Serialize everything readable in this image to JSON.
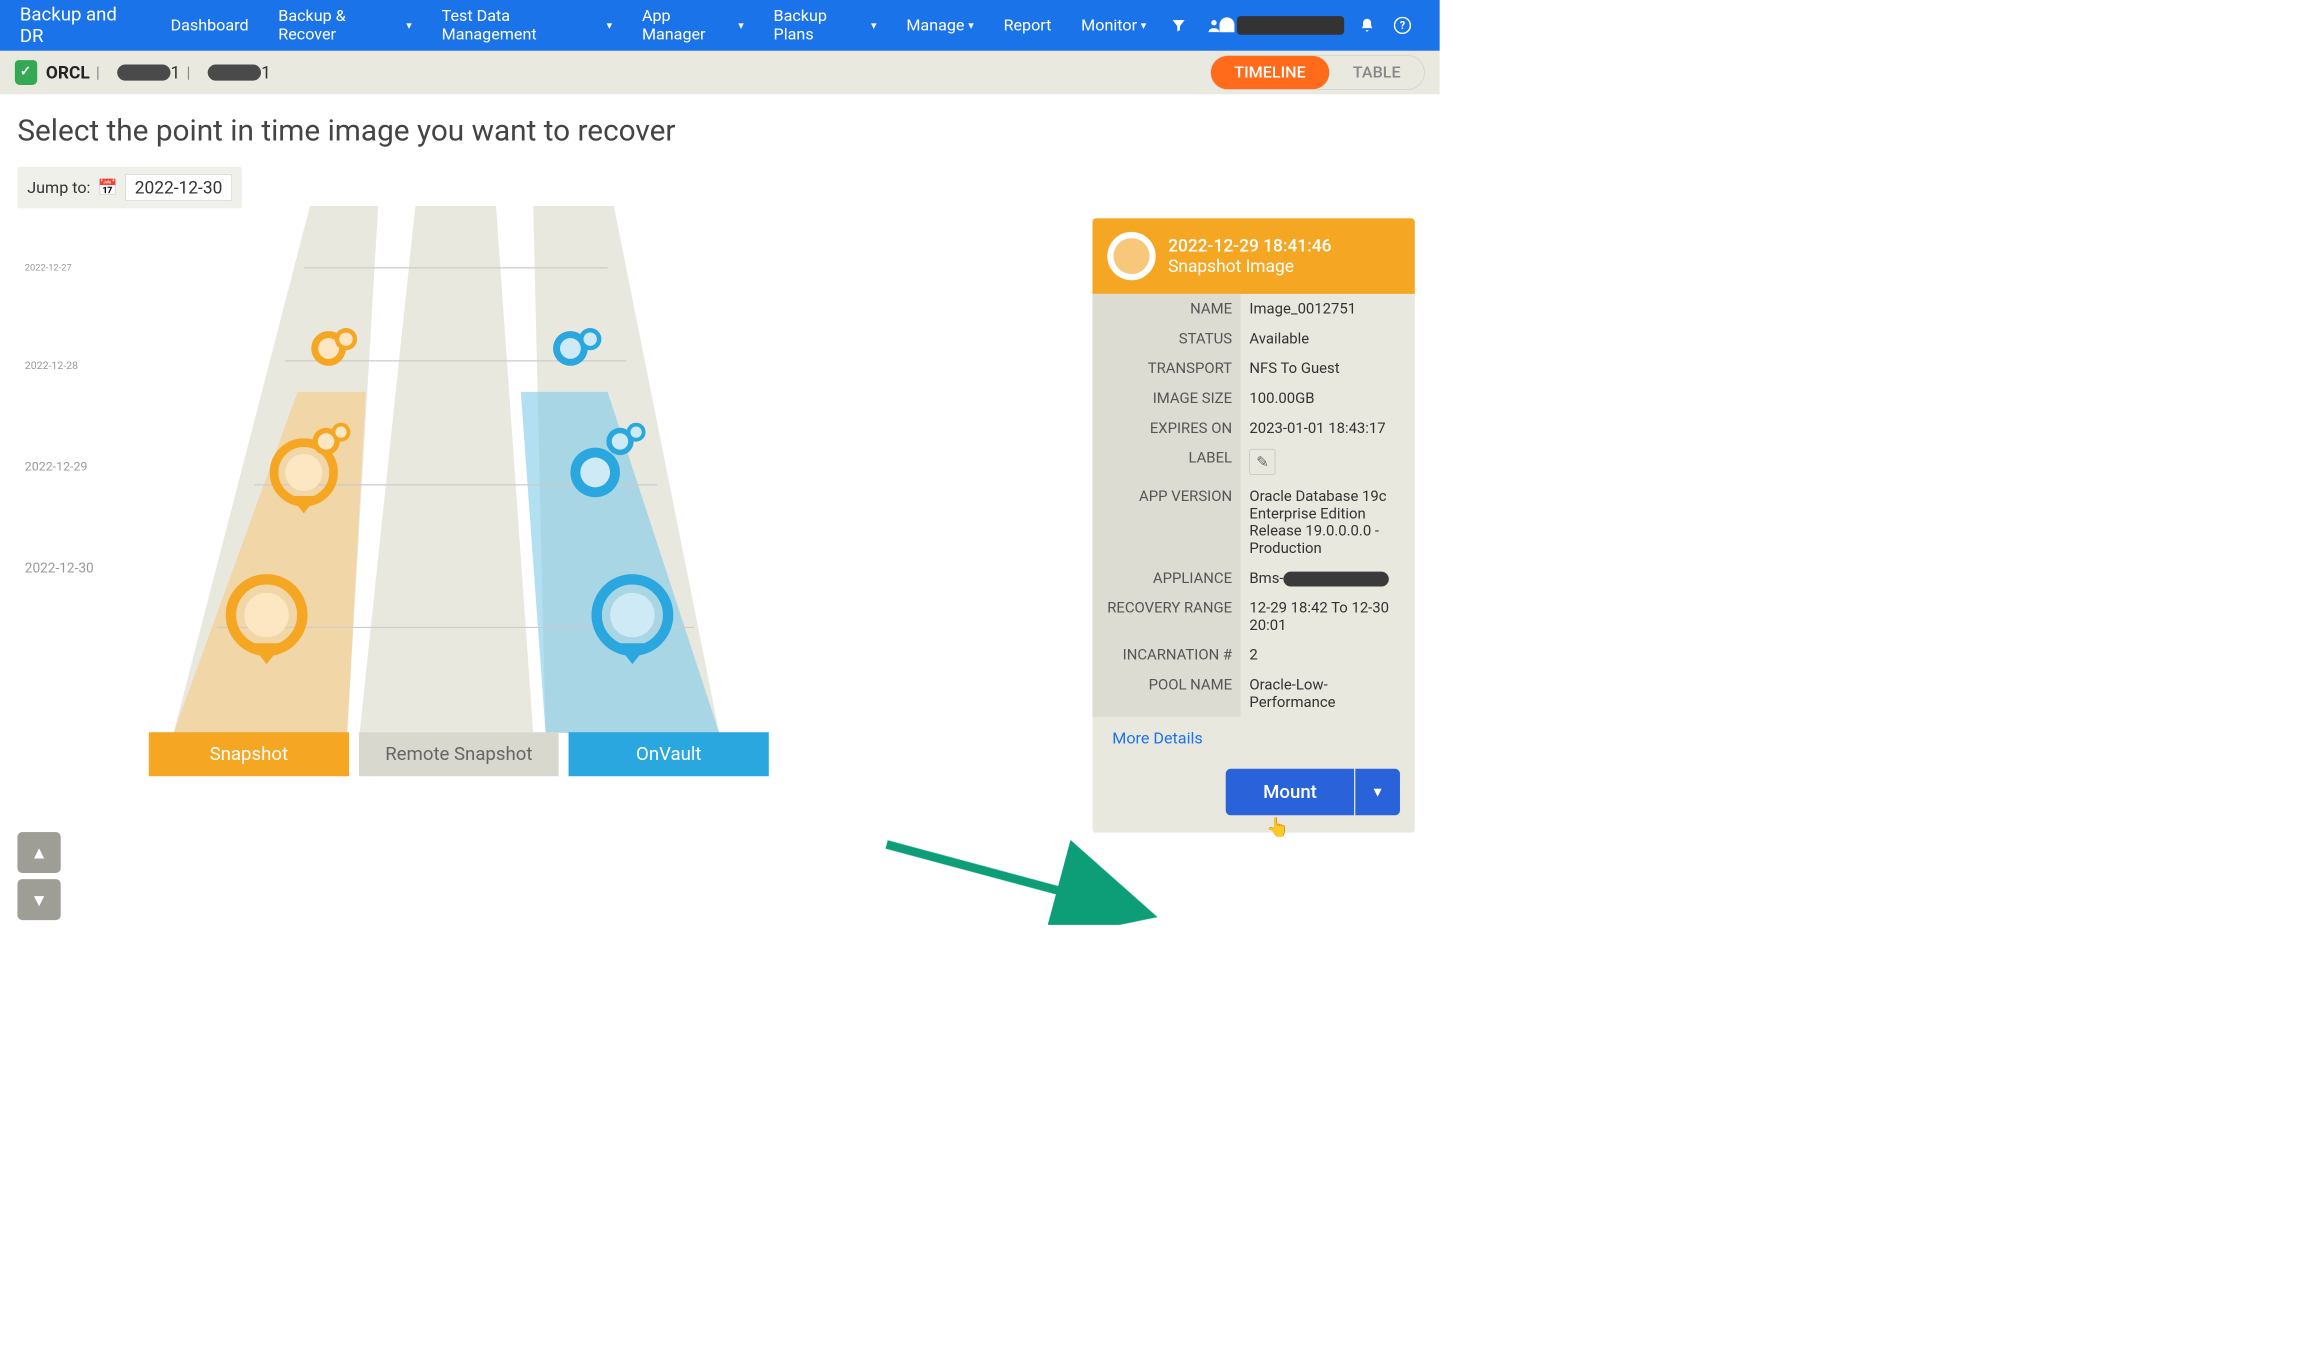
{
  "nav": {
    "brand": "Backup and DR",
    "items": [
      "Dashboard",
      "Backup & Recover",
      "Test Data Management",
      "App Manager",
      "Backup Plans",
      "Manage",
      "Report",
      "Monitor"
    ],
    "dropdown_flags": [
      false,
      true,
      true,
      true,
      true,
      true,
      false,
      true
    ]
  },
  "subheader": {
    "app": "ORCL",
    "host_suffix1": "1",
    "host_suffix2": "1",
    "view_timeline": "TIMELINE",
    "view_table": "TABLE"
  },
  "page": {
    "title": "Select the point in time image you want to recover",
    "jump_label": "Jump to:",
    "jump_date": "2022-12-30"
  },
  "ticks": [
    "2022-12-27",
    "2022-12-28",
    "2022-12-29",
    "2022-12-30"
  ],
  "lanes": {
    "snapshot": "Snapshot",
    "remote": "Remote Snapshot",
    "onvault": "OnVault"
  },
  "details": {
    "datetime": "2022-12-29  18:41:46",
    "type": "Snapshot Image",
    "rows": [
      {
        "k": "NAME",
        "v": "Image_0012751"
      },
      {
        "k": "STATUS",
        "v": "Available"
      },
      {
        "k": "TRANSPORT",
        "v": "NFS To Guest"
      },
      {
        "k": "IMAGE SIZE",
        "v": "100.00GB"
      },
      {
        "k": "EXPIRES ON",
        "v": "2023-01-01 18:43:17"
      },
      {
        "k": "LABEL",
        "v": ""
      },
      {
        "k": "APP VERSION",
        "v": "Oracle Database 19c Enterprise Edition Release 19.0.0.0.0 - Production"
      },
      {
        "k": "APPLIANCE",
        "v": "Bms-"
      },
      {
        "k": "RECOVERY RANGE",
        "v": "12-29 18:42 To 12-30 20:01"
      },
      {
        "k": "INCARNATION #",
        "v": "2"
      },
      {
        "k": "POOL NAME",
        "v": "Oracle-Low-Performance"
      }
    ],
    "more": "More Details",
    "mount": "Mount"
  }
}
